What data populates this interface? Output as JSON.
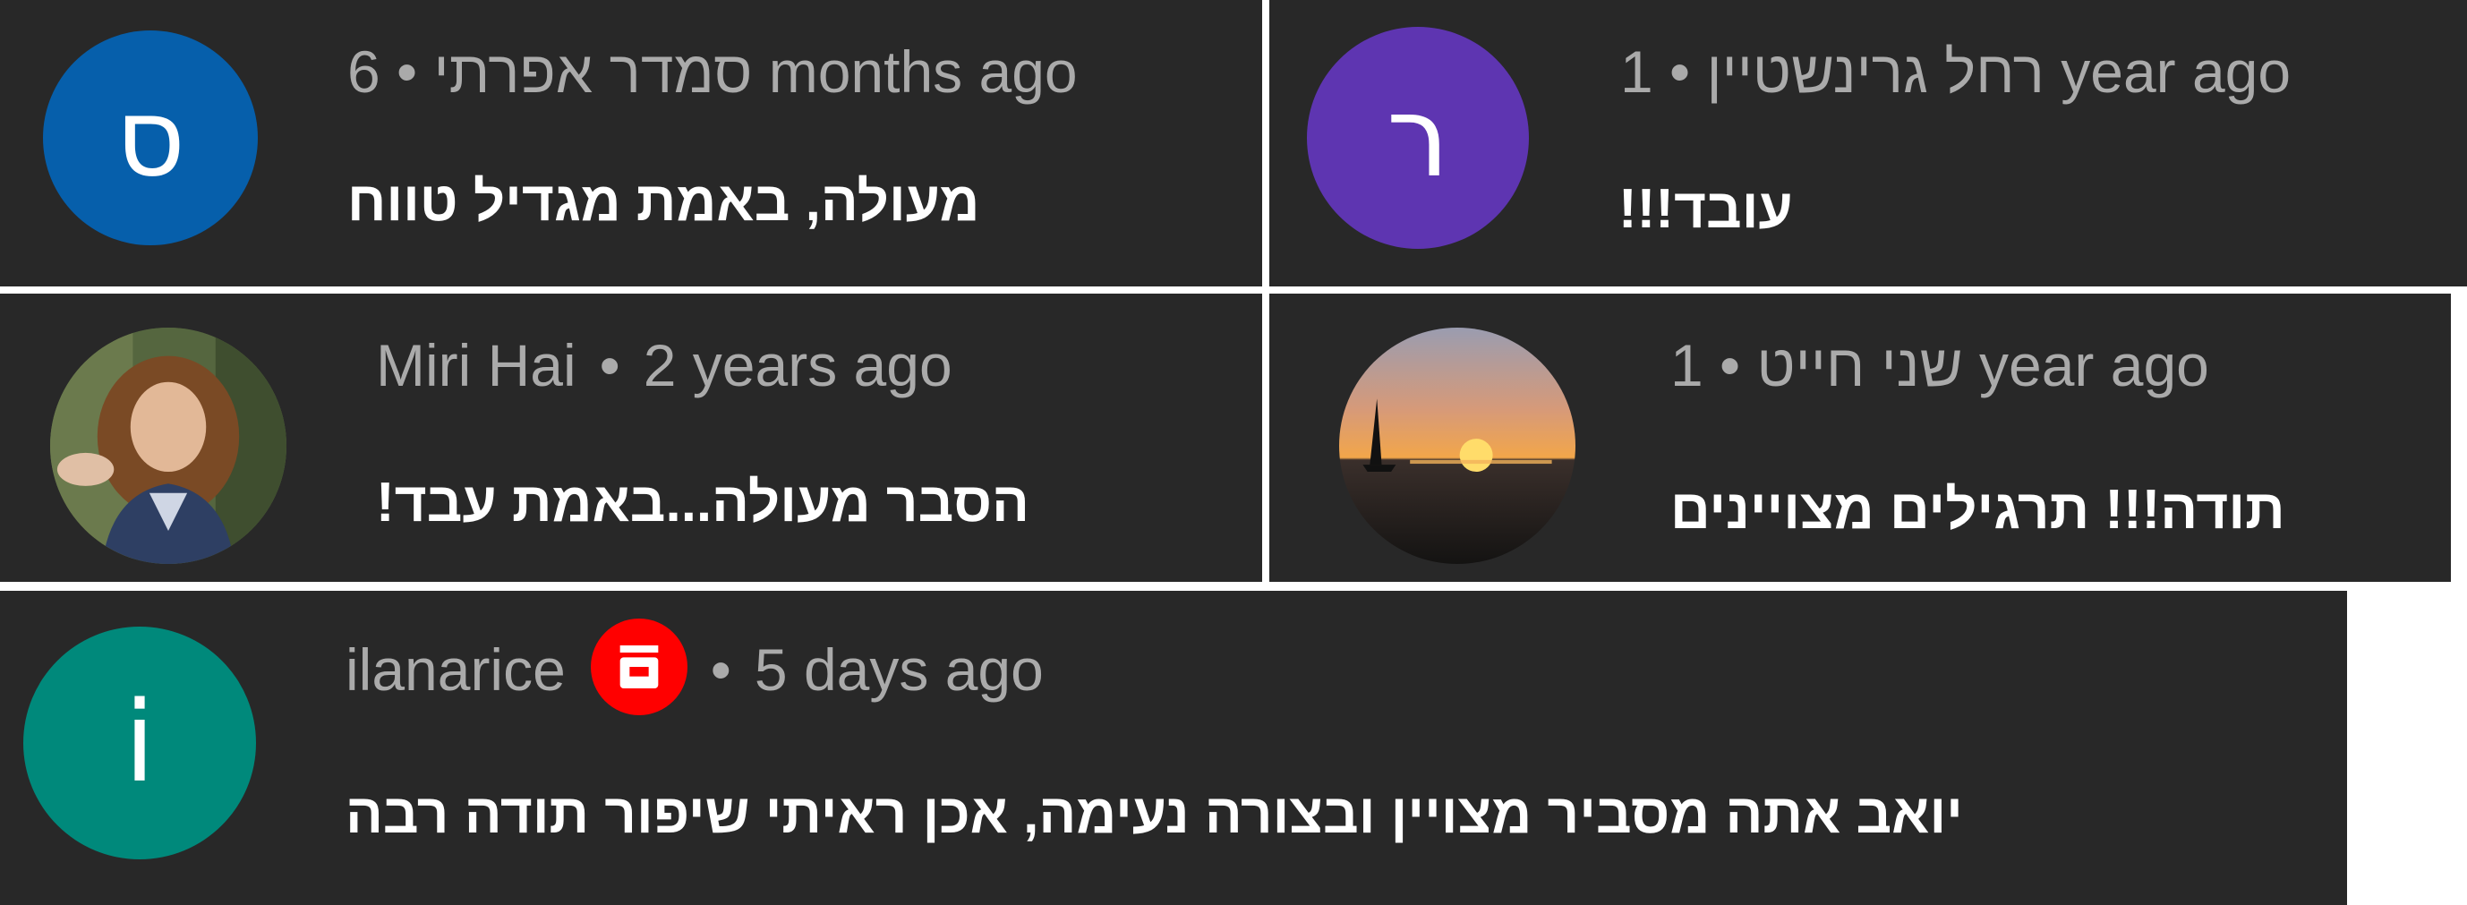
{
  "comments": [
    {
      "avatar_letter": "ס",
      "avatar_color": "#065fab",
      "meta_text": "6 • סמדר אפרתי months ago",
      "body": "מעולה, באמת מגדיל טווח"
    },
    {
      "avatar_letter": "ר",
      "avatar_color": "#5e35b1",
      "meta_text": "1 • רחל גרינשטיין year ago",
      "body": "עובד!!!"
    },
    {
      "avatar_icon": "profile-photo-icon",
      "author": "Miri Hai",
      "time": "2 years ago",
      "body": "הסבר מעולה...באמת עבד!"
    },
    {
      "avatar_icon": "sunset-sailboat-photo-icon",
      "meta_text": "1 • שני חייט year ago",
      "body": "תודה!!! תרגילים מצויינים"
    },
    {
      "avatar_letter": "i",
      "avatar_color": "#00897b",
      "author": "ilanarice",
      "badge_icon": "red-badge-icon",
      "badge_color": "#ff0000",
      "time": "5 days ago",
      "body": "יואב אתה מסביר  מצויין ובצורה נעימה, אכן ראיתי שיפור  תודה רבה"
    }
  ],
  "separator": "•"
}
